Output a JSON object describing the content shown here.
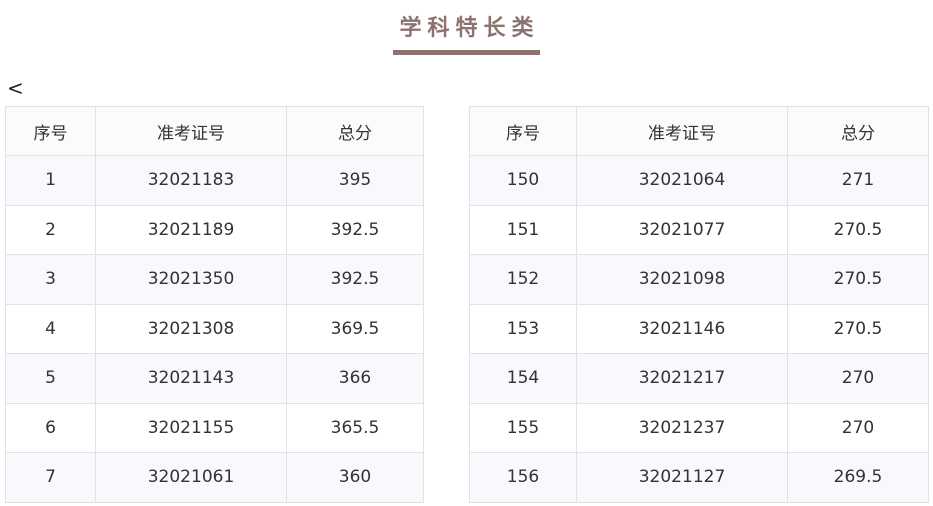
{
  "title": "学科特长类",
  "back_icon_glyph": "<",
  "headers": [
    "序号",
    "准考证号",
    "总分"
  ],
  "left_rows": [
    [
      "1",
      "32021183",
      "395"
    ],
    [
      "2",
      "32021189",
      "392.5"
    ],
    [
      "3",
      "32021350",
      "392.5"
    ],
    [
      "4",
      "32021308",
      "369.5"
    ],
    [
      "5",
      "32021143",
      "366"
    ],
    [
      "6",
      "32021155",
      "365.5"
    ],
    [
      "7",
      "32021061",
      "360"
    ]
  ],
  "right_rows": [
    [
      "150",
      "32021064",
      "271"
    ],
    [
      "151",
      "32021077",
      "270.5"
    ],
    [
      "152",
      "32021098",
      "270.5"
    ],
    [
      "153",
      "32021146",
      "270.5"
    ],
    [
      "154",
      "32021217",
      "270"
    ],
    [
      "155",
      "32021237",
      "270"
    ],
    [
      "156",
      "32021127",
      "269.5"
    ]
  ]
}
